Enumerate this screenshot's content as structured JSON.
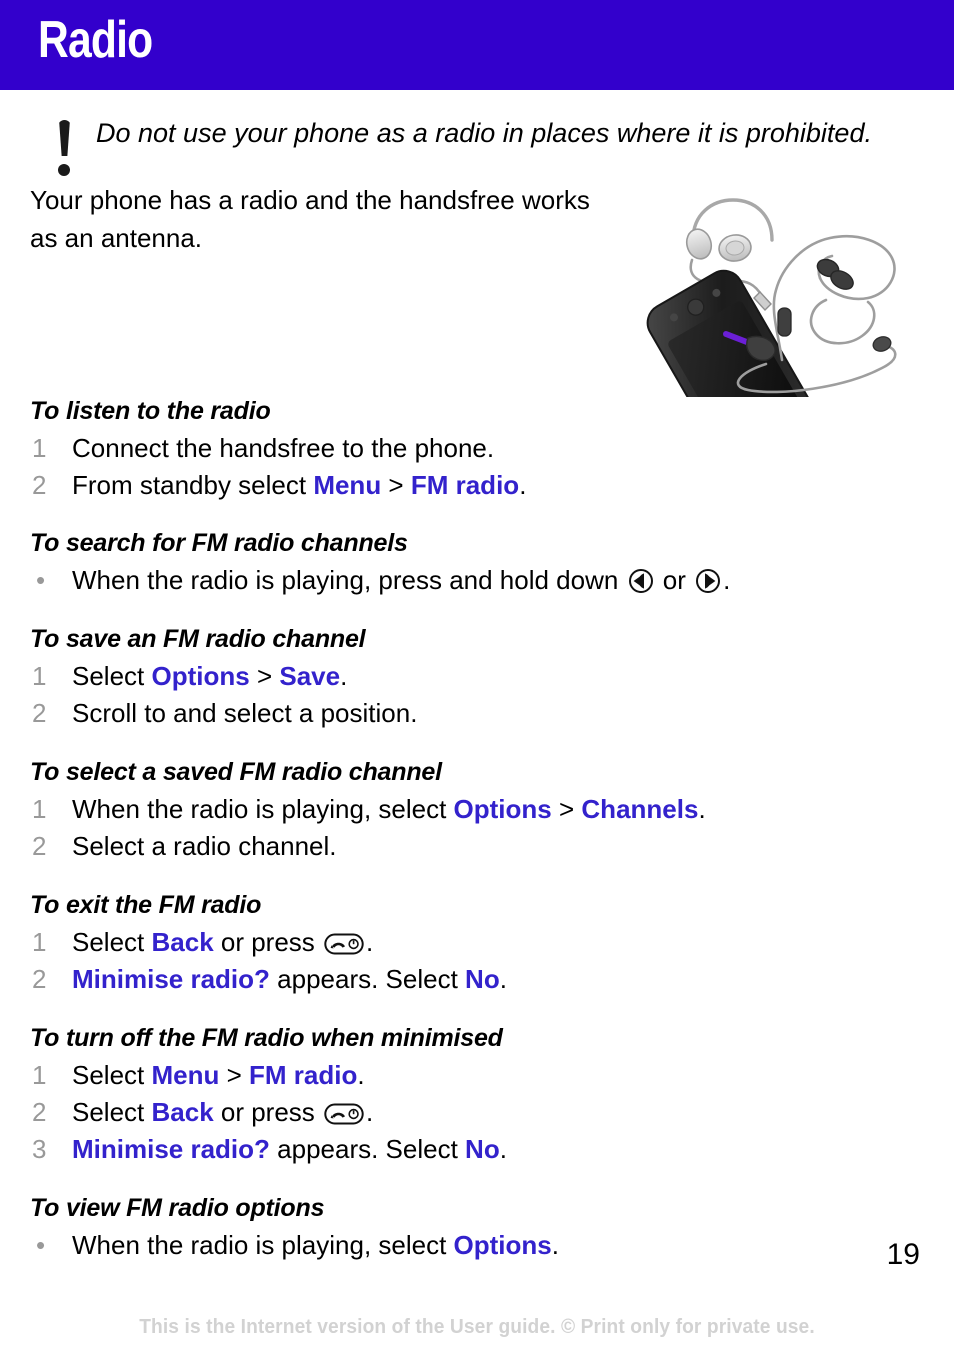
{
  "header": {
    "title": "Radio",
    "band_color": "#3300cc",
    "title_color": "#ffffff"
  },
  "colors": {
    "ui_term": "#3322cc",
    "step_number": "#999999",
    "footer": "#d2d2d2",
    "body": "#000000"
  },
  "note": {
    "icon": "exclamation-icon",
    "text": "Do not use your phone as a radio in places where it is prohibited."
  },
  "intro": {
    "text": "Your phone has a radio and the handsfree works as an antenna."
  },
  "figure": {
    "name": "phone-with-handsfree-photo",
    "caption": ""
  },
  "sections": [
    {
      "heading": "To listen to the radio",
      "steps": [
        {
          "marker": "1",
          "type": "number",
          "parts": [
            {
              "t": "Connect the handsfree to the phone.",
              "style": "plain"
            }
          ]
        },
        {
          "marker": "2",
          "type": "number",
          "parts": [
            {
              "t": "From standby select ",
              "style": "plain"
            },
            {
              "t": "Menu",
              "style": "ui"
            },
            {
              "t": " > ",
              "style": "sep"
            },
            {
              "t": "FM radio",
              "style": "ui"
            },
            {
              "t": ".",
              "style": "plain"
            }
          ]
        }
      ]
    },
    {
      "heading": "To search for FM radio channels",
      "steps": [
        {
          "marker": "•",
          "type": "bullet",
          "parts": [
            {
              "t": "When the radio is playing, press and hold down ",
              "style": "plain"
            },
            {
              "t": "nav-key-left-icon",
              "style": "icon"
            },
            {
              "t": " or ",
              "style": "plain"
            },
            {
              "t": "nav-key-right-icon",
              "style": "icon"
            },
            {
              "t": ".",
              "style": "plain"
            }
          ]
        }
      ]
    },
    {
      "heading": "To save an FM radio channel",
      "steps": [
        {
          "marker": "1",
          "type": "number",
          "parts": [
            {
              "t": "Select ",
              "style": "plain"
            },
            {
              "t": "Options",
              "style": "ui"
            },
            {
              "t": " > ",
              "style": "sep"
            },
            {
              "t": "Save",
              "style": "ui"
            },
            {
              "t": ".",
              "style": "plain"
            }
          ]
        },
        {
          "marker": "2",
          "type": "number",
          "parts": [
            {
              "t": "Scroll to and select a position.",
              "style": "plain"
            }
          ]
        }
      ]
    },
    {
      "heading": "To select a saved FM radio channel",
      "steps": [
        {
          "marker": "1",
          "type": "number",
          "parts": [
            {
              "t": "When the radio is playing, select ",
              "style": "plain"
            },
            {
              "t": "Options",
              "style": "ui"
            },
            {
              "t": " > ",
              "style": "sep"
            },
            {
              "t": "Channels",
              "style": "ui"
            },
            {
              "t": ".",
              "style": "plain"
            }
          ]
        },
        {
          "marker": "2",
          "type": "number",
          "parts": [
            {
              "t": "Select a radio channel.",
              "style": "plain"
            }
          ]
        }
      ]
    },
    {
      "heading": "To exit the FM radio",
      "steps": [
        {
          "marker": "1",
          "type": "number",
          "parts": [
            {
              "t": "Select ",
              "style": "plain"
            },
            {
              "t": "Back",
              "style": "ui"
            },
            {
              "t": " or press ",
              "style": "plain"
            },
            {
              "t": "end-call-key-icon",
              "style": "icon"
            },
            {
              "t": ".",
              "style": "plain"
            }
          ]
        },
        {
          "marker": "2",
          "type": "number",
          "parts": [
            {
              "t": "Minimise radio?",
              "style": "ui"
            },
            {
              "t": " appears. Select ",
              "style": "plain"
            },
            {
              "t": "No",
              "style": "ui"
            },
            {
              "t": ".",
              "style": "plain"
            }
          ]
        }
      ]
    },
    {
      "heading": "To turn off the FM radio when minimised",
      "steps": [
        {
          "marker": "1",
          "type": "number",
          "parts": [
            {
              "t": "Select ",
              "style": "plain"
            },
            {
              "t": "Menu",
              "style": "ui"
            },
            {
              "t": " > ",
              "style": "sep"
            },
            {
              "t": "FM radio",
              "style": "ui"
            },
            {
              "t": ".",
              "style": "plain"
            }
          ]
        },
        {
          "marker": "2",
          "type": "number",
          "parts": [
            {
              "t": "Select ",
              "style": "plain"
            },
            {
              "t": "Back",
              "style": "ui"
            },
            {
              "t": " or press ",
              "style": "plain"
            },
            {
              "t": "end-call-key-icon",
              "style": "icon"
            },
            {
              "t": ".",
              "style": "plain"
            }
          ]
        },
        {
          "marker": "3",
          "type": "number",
          "parts": [
            {
              "t": "Minimise radio?",
              "style": "ui"
            },
            {
              "t": " appears. Select ",
              "style": "plain"
            },
            {
              "t": "No",
              "style": "ui"
            },
            {
              "t": ".",
              "style": "plain"
            }
          ]
        }
      ]
    },
    {
      "heading": "To view FM radio options",
      "steps": [
        {
          "marker": "•",
          "type": "bullet",
          "parts": [
            {
              "t": "When the radio is playing, select ",
              "style": "plain"
            },
            {
              "t": "Options",
              "style": "ui"
            },
            {
              "t": ".",
              "style": "plain"
            }
          ]
        }
      ]
    }
  ],
  "page_number": "19",
  "footer": {
    "text": "This is the Internet version of the User guide. © Print only for private use."
  }
}
